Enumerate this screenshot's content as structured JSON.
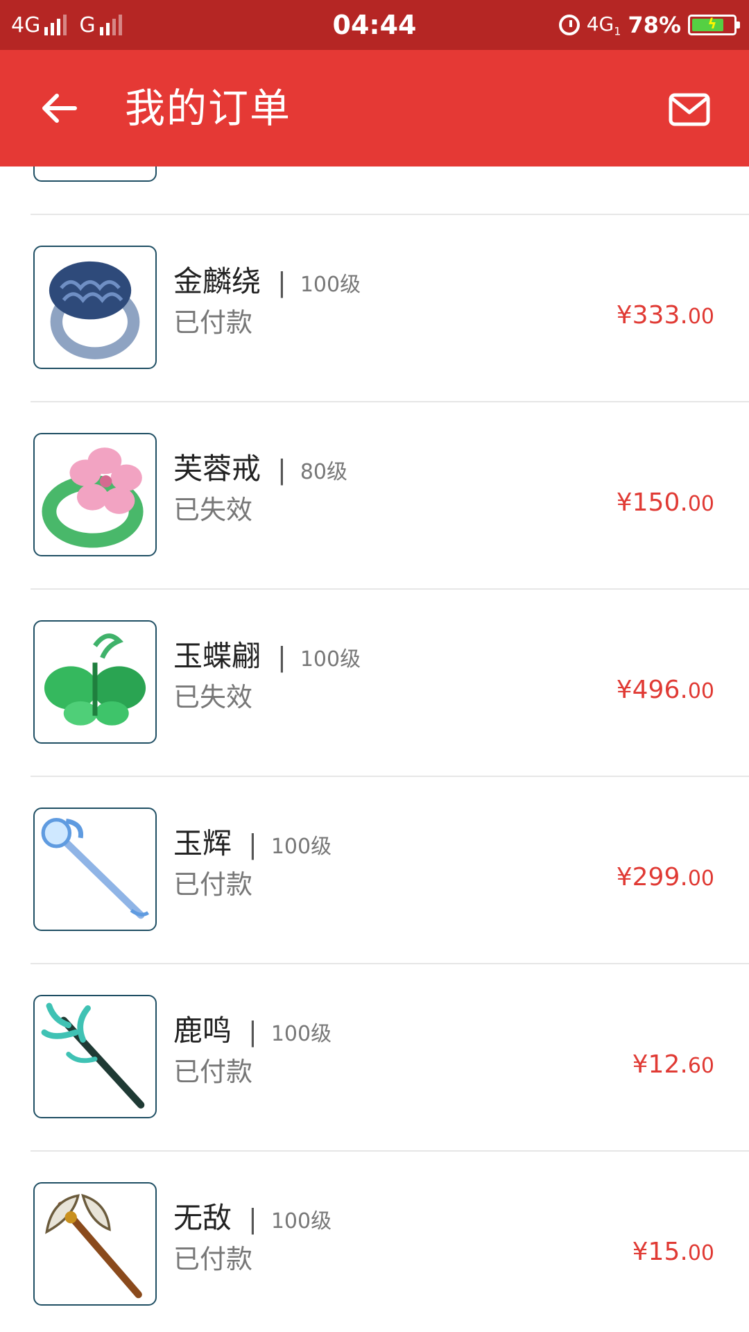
{
  "status_bar": {
    "sim1": "4G",
    "sim2": "G",
    "time": "04:44",
    "network": "4G",
    "network_sub": "1",
    "battery": "78%",
    "battery_level": 0.78
  },
  "header": {
    "title": "我的订单",
    "back_icon": "arrow-left-icon",
    "mail_icon": "mail-icon"
  },
  "orders": [
    {
      "name": "金麟绕",
      "level": "100级",
      "status": "已付款",
      "price_main": "¥333.",
      "price_cents": "00",
      "icon": "ring-icon"
    },
    {
      "name": "芙蓉戒",
      "level": "80级",
      "status": "已失效",
      "price_main": "¥150.",
      "price_cents": "00",
      "icon": "flower-ring-icon"
    },
    {
      "name": "玉蝶翩",
      "level": "100级",
      "status": "已失效",
      "price_main": "¥496.",
      "price_cents": "00",
      "icon": "jade-butterfly-icon"
    },
    {
      "name": "玉辉",
      "level": "100级",
      "status": "已付款",
      "price_main": "¥299.",
      "price_cents": "00",
      "icon": "staff-icon"
    },
    {
      "name": "鹿鸣",
      "level": "100级",
      "status": "已付款",
      "price_main": "¥12.",
      "price_cents": "60",
      "icon": "antler-staff-icon"
    },
    {
      "name": "无敌",
      "level": "100级",
      "status": "已付款",
      "price_main": "¥15.",
      "price_cents": "00",
      "icon": "axe-icon"
    }
  ],
  "colors": {
    "status_bar": "#b52624",
    "app_bar": "#e53935",
    "price": "#e03a34"
  }
}
